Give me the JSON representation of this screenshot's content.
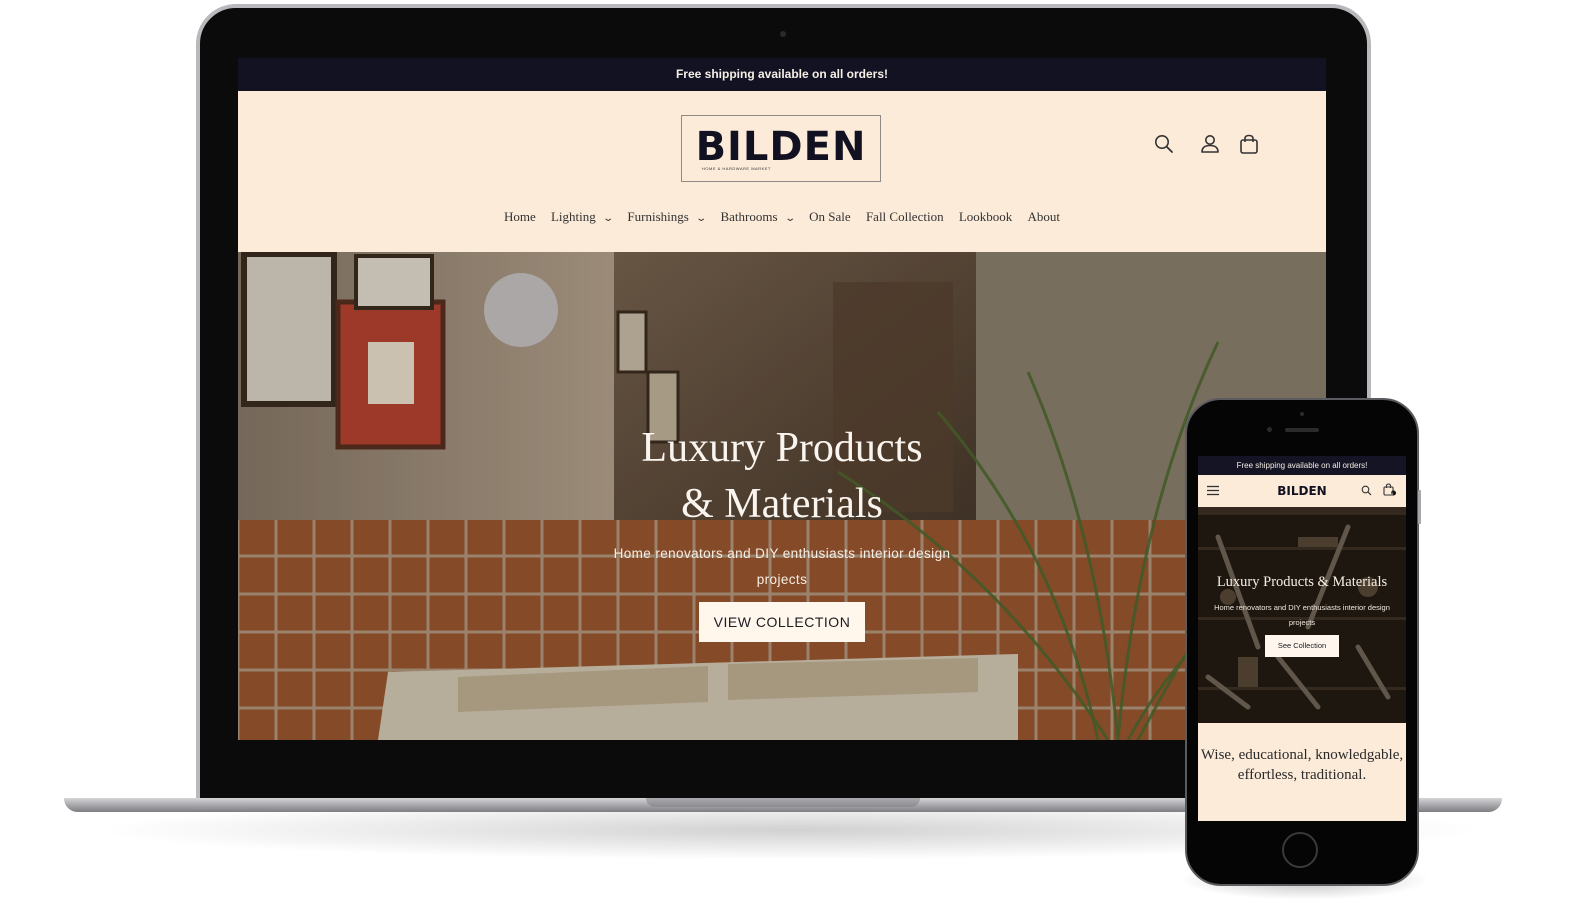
{
  "desktop": {
    "announcement": "Free shipping available on all orders!",
    "logo": {
      "name": "BILDEN",
      "tagline": "HOME & HARDWARE MARKET"
    },
    "header_icons": [
      "search-icon",
      "account-icon",
      "cart-icon"
    ],
    "nav": [
      {
        "label": "Home",
        "dropdown": false
      },
      {
        "label": "Lighting",
        "dropdown": true
      },
      {
        "label": "Furnishings",
        "dropdown": true
      },
      {
        "label": "Bathrooms",
        "dropdown": true
      },
      {
        "label": "On Sale",
        "dropdown": false
      },
      {
        "label": "Fall Collection",
        "dropdown": false
      },
      {
        "label": "Lookbook",
        "dropdown": false
      },
      {
        "label": "About",
        "dropdown": false
      }
    ],
    "hero": {
      "title_line1": "Luxury Products",
      "title_line2": "& Materials",
      "subtitle": "Home renovators and DIY enthusiasts interior design projects",
      "cta": "VIEW COLLECTION"
    }
  },
  "mobile": {
    "announcement": "Free shipping available on all orders!",
    "logo": "BILDEN",
    "cart_count": "0",
    "hero": {
      "title": "Luxury Products & Materials",
      "subtitle": "Home renovators and DIY enthusiasts interior design projects",
      "cta": "See Collection"
    },
    "tagline": "Wise, educational, knowledgable, effortless, traditional."
  },
  "colors": {
    "header_bg": "#fdebd9",
    "announcement_bg": "#121222",
    "text_dark": "#111122",
    "button_bg": "#fff6ec"
  }
}
